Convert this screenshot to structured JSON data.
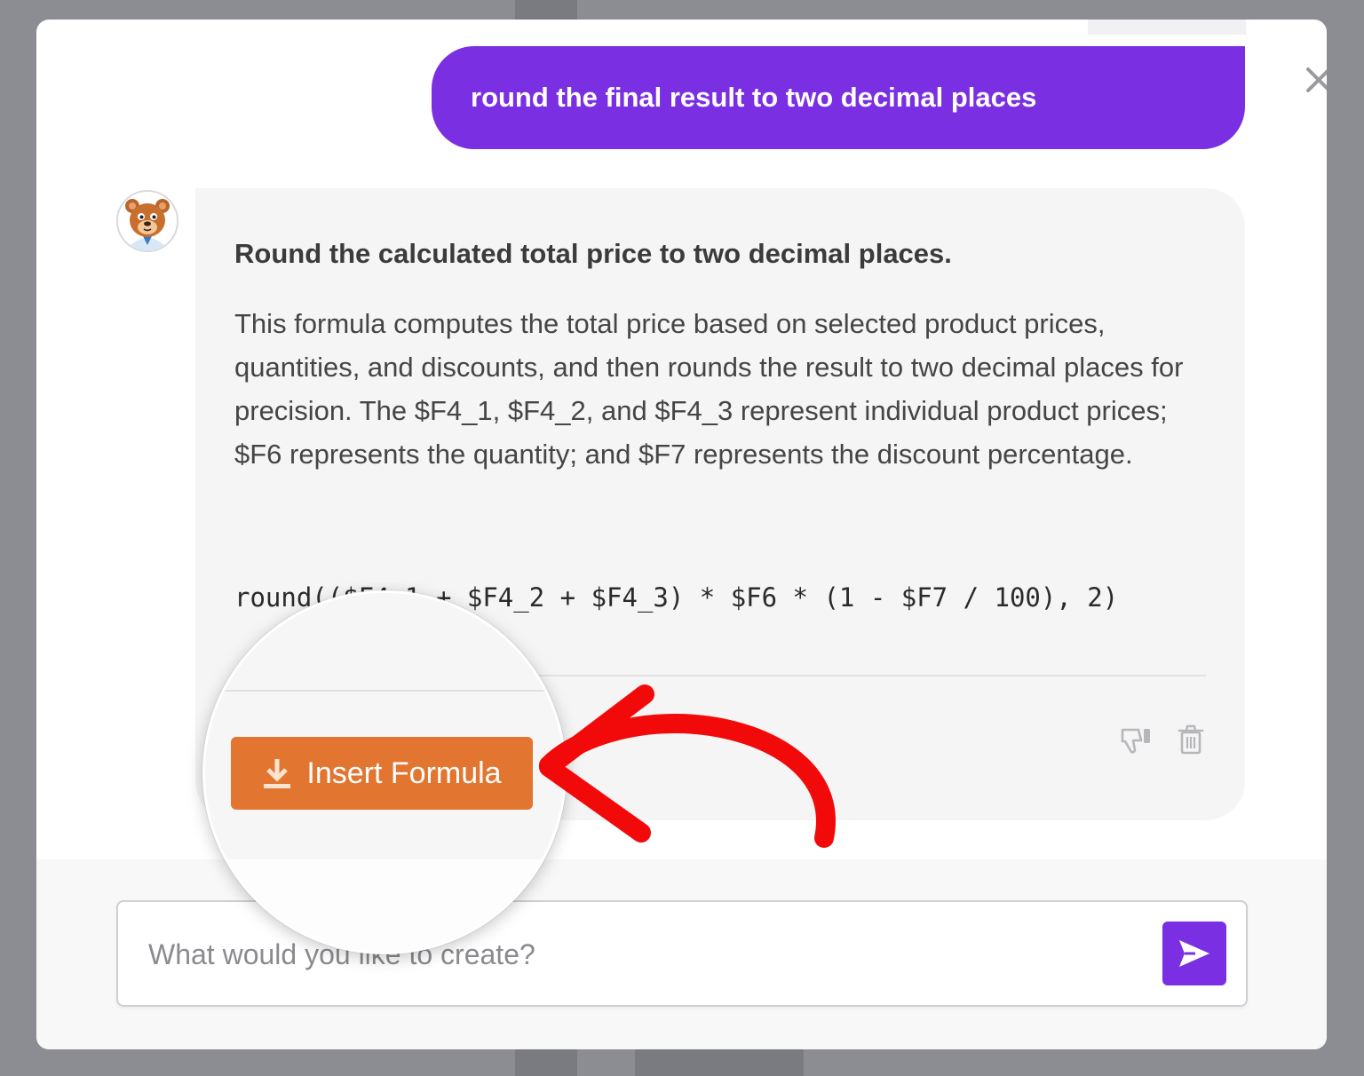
{
  "colors": {
    "accent_purple": "#7b2fe3",
    "insert_button": "#e27631",
    "annotation_arrow": "#f20a0a",
    "card_background": "#f5f5f5"
  },
  "user_message": {
    "text": "round the final result to two decimal places"
  },
  "assistant_message": {
    "avatar_icon": "bear-mascot-avatar",
    "title": "Round the calculated total price to two decimal places.",
    "description": "This formula computes the total price based on selected product prices, quantities, and discounts, and then rounds the result to two decimal places for precision. The $F4_1, $F4_2, and $F4_3 represent individual product prices; $F6 represents the quantity; and $F7 represents the discount percentage.",
    "formula": "round(($F4_1 + $F4_2 + $F4_3) * $F6 * (1 - $F7 / 100), 2)",
    "insert_button_label": "Insert Formula",
    "insert_button_icon": "download-icon",
    "actions": [
      "thumbs-down-icon",
      "trash-icon"
    ]
  },
  "composer": {
    "placeholder": "What would you like to create?",
    "send_icon": "send-icon"
  },
  "close_icon": "close-icon",
  "annotation": "red-curved-arrow"
}
